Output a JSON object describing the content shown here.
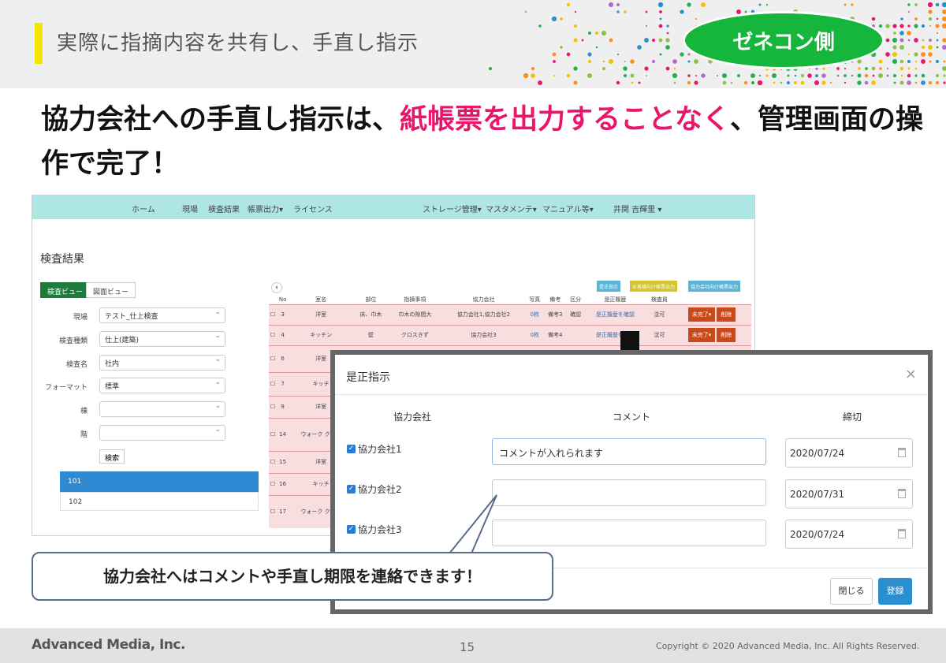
{
  "slide": {
    "title": "実際に指摘内容を共有し、手直し指示",
    "badge": "ゼネコン側",
    "headline_before": "協力会社への手直し指示は、",
    "headline_highlight": "紙帳票を出力することなく",
    "headline_after": "、管理画面の操作で完了！"
  },
  "app": {
    "nav": [
      "ホーム",
      "現場",
      "検査結果",
      "帳票出力▾",
      "ライセンス",
      "ストレージ管理▾",
      "マスタメンテ▾",
      "マニュアル等▾",
      "井関 吉輝里 ▾"
    ],
    "heading": "検査結果",
    "tabs": {
      "active": "検査ビュー",
      "idle": "図面ビュー"
    },
    "filters": [
      {
        "label": "現場",
        "value": "テスト_仕上検査"
      },
      {
        "label": "検査種類",
        "value": "仕上(建築)"
      },
      {
        "label": "検査名",
        "value": "社内"
      },
      {
        "label": "フォーマット",
        "value": "標準"
      },
      {
        "label": "棟",
        "value": ""
      },
      {
        "label": "階",
        "value": ""
      }
    ],
    "search_button": "検索",
    "list_items": [
      "101",
      "102"
    ],
    "top_buttons": [
      "是正指示",
      "お客様向け帳票出力",
      "協力会社向け帳票出力"
    ],
    "table_headers": [
      "",
      "No",
      "室名",
      "部位",
      "指摘事項",
      "協力会社",
      "写真",
      "備考",
      "区分",
      "是正履歴",
      "検査員",
      ""
    ],
    "rows": [
      {
        "no": "3",
        "room": "洋室",
        "part": "床、巾木",
        "issue": "巾木の隙間大",
        "company": "協力会社1,協力会社2",
        "photo": "0枚",
        "note": "備考3",
        "cat": "確認",
        "history": "是正履歴を確認",
        "inspector": "沈可",
        "status": "未完了▾",
        "del": "削除"
      },
      {
        "no": "4",
        "room": "キッチン",
        "part": "壁",
        "issue": "クロスきず",
        "company": "協力会社3",
        "photo": "0枚",
        "note": "備考4",
        "cat": "",
        "history": "是正履歴を確認",
        "inspector": "沈可",
        "status": "未完了▾",
        "del": "削除"
      },
      {
        "no": "6",
        "room": "洋室"
      },
      {
        "no": "7",
        "room": "キッチ"
      },
      {
        "no": "9",
        "room": "洋室"
      },
      {
        "no": "14",
        "room": "ウォーク クロゼ"
      },
      {
        "no": "15",
        "room": "洋室"
      },
      {
        "no": "16",
        "room": "キッチ"
      },
      {
        "no": "17",
        "room": "ウォーク クロゼ"
      }
    ]
  },
  "modal": {
    "title": "是正指示",
    "close_icon": "×",
    "headers": {
      "company": "協力会社",
      "comment": "コメント",
      "deadline": "締切"
    },
    "rows": [
      {
        "company": "協力会社1",
        "comment": "コメントが入れられます",
        "deadline": "2020/07/24"
      },
      {
        "company": "協力会社2",
        "comment": "",
        "deadline": "2020/07/31"
      },
      {
        "company": "協力会社3",
        "comment": "",
        "deadline": "2020/07/24"
      }
    ],
    "close_button": "閉じる",
    "register_button": "登録"
  },
  "callout": "協力会社へはコメントや手直し期限を連絡できます！",
  "footer": {
    "logo": "Advanced Media, Inc.",
    "page": "15",
    "copyright": "Copyright © 2020 Advanced Media, Inc. All Rights Reserved."
  },
  "colors": {
    "accent_pink": "#e8176a",
    "badge_green": "#16b53c",
    "nav_teal": "#aee6e6"
  }
}
